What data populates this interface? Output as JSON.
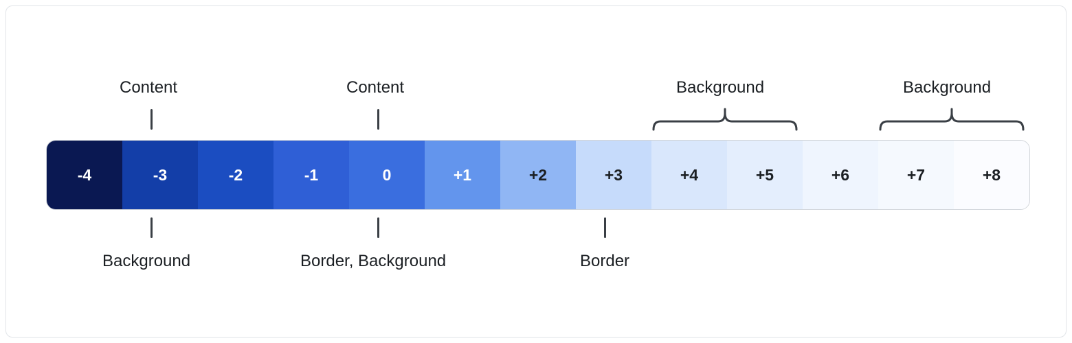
{
  "swatches": [
    {
      "value": "-4",
      "bg": "#0a1852",
      "fg": "#ffffff"
    },
    {
      "value": "-3",
      "bg": "#133ea8",
      "fg": "#ffffff"
    },
    {
      "value": "-2",
      "bg": "#1b4dc1",
      "fg": "#ffffff"
    },
    {
      "value": "-1",
      "bg": "#2f5fd6",
      "fg": "#ffffff"
    },
    {
      "value": "0",
      "bg": "#3a6edf",
      "fg": "#ffffff"
    },
    {
      "value": "+1",
      "bg": "#6395ed",
      "fg": "#ffffff"
    },
    {
      "value": "+2",
      "bg": "#90b6f4",
      "fg": "#1b1f23"
    },
    {
      "value": "+3",
      "bg": "#c6dbfb",
      "fg": "#1b1f23"
    },
    {
      "value": "+4",
      "bg": "#d9e7fc",
      "fg": "#1b1f23"
    },
    {
      "value": "+5",
      "bg": "#e4eefd",
      "fg": "#1b1f23"
    },
    {
      "value": "+6",
      "bg": "#eff5fe",
      "fg": "#1b1f23"
    },
    {
      "value": "+7",
      "bg": "#f5f9fe",
      "fg": "#1b1f23"
    },
    {
      "value": "+8",
      "bg": "#fbfcff",
      "fg": "#1b1f23"
    }
  ],
  "labels": {
    "top1": "Content",
    "top2": "Content",
    "top3": "Background",
    "top4": "Background",
    "bot1": "Background",
    "bot2": "Border, Background",
    "bot3": "Border"
  }
}
